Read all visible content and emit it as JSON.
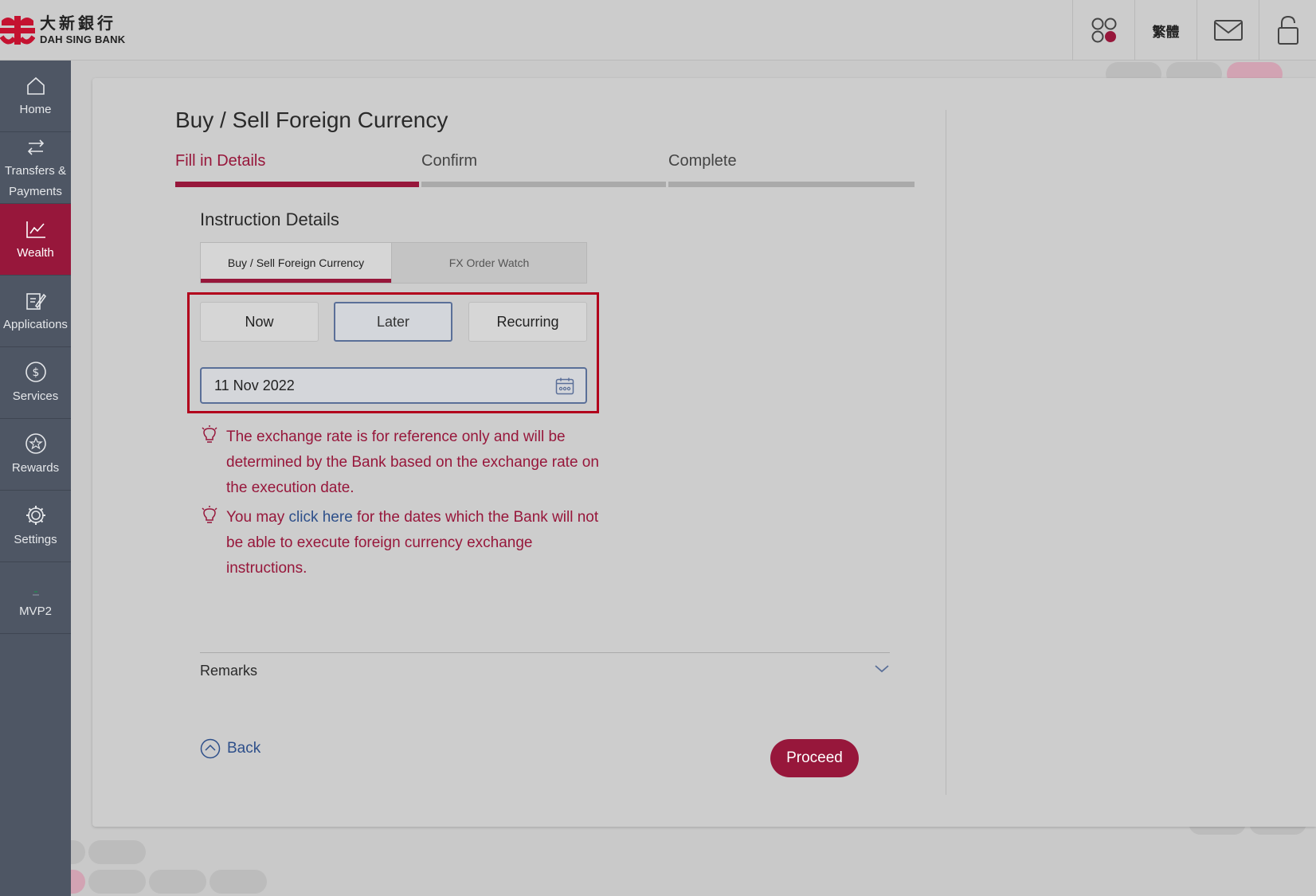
{
  "brand": {
    "name_cn": "大新銀行",
    "name_en": "DAH SING BANK"
  },
  "header": {
    "language_label": "繁體",
    "icons": [
      "apps-icon",
      "mail-icon",
      "lock-icon"
    ]
  },
  "sidebar": {
    "items": [
      {
        "label": "Home",
        "icon": "home-icon"
      },
      {
        "label": "Transfers & Payments",
        "icon": "transfer-icon"
      },
      {
        "label": "Wealth",
        "icon": "chart-icon",
        "active": true
      },
      {
        "label": "Applications",
        "icon": "edit-icon"
      },
      {
        "label": "Services",
        "icon": "dollar-icon"
      },
      {
        "label": "Rewards",
        "icon": "star-icon"
      },
      {
        "label": "Settings",
        "icon": "gear-icon"
      },
      {
        "label": "MVP2",
        "icon": "mvp-icon"
      }
    ]
  },
  "page": {
    "title": "Buy / Sell Foreign Currency",
    "steps": [
      "Fill in Details",
      "Confirm",
      "Complete"
    ],
    "active_step": 0,
    "section_title": "Instruction Details",
    "tabs": [
      "Buy / Sell Foreign Currency",
      "FX Order Watch"
    ],
    "timing_options": [
      "Now",
      "Later",
      "Recurring"
    ],
    "selected_timing": "Later",
    "date_value": "11 Nov 2022",
    "note1": "The exchange rate is for reference only and will be determined by the Bank based on the exchange rate on the execution date.",
    "note2_prefix": "You may ",
    "note2_link": "click here",
    "note2_suffix": " for the dates which the Bank will not be able to execute foreign currency exchange instructions.",
    "remarks_label": "Remarks",
    "back_label": "Back",
    "proceed_label": "Proceed"
  },
  "colors": {
    "brand_red": "#97173b",
    "sidebar_bg": "#4e5664",
    "link_blue": "#2d4f8a",
    "highlight_red": "#b2001c"
  }
}
